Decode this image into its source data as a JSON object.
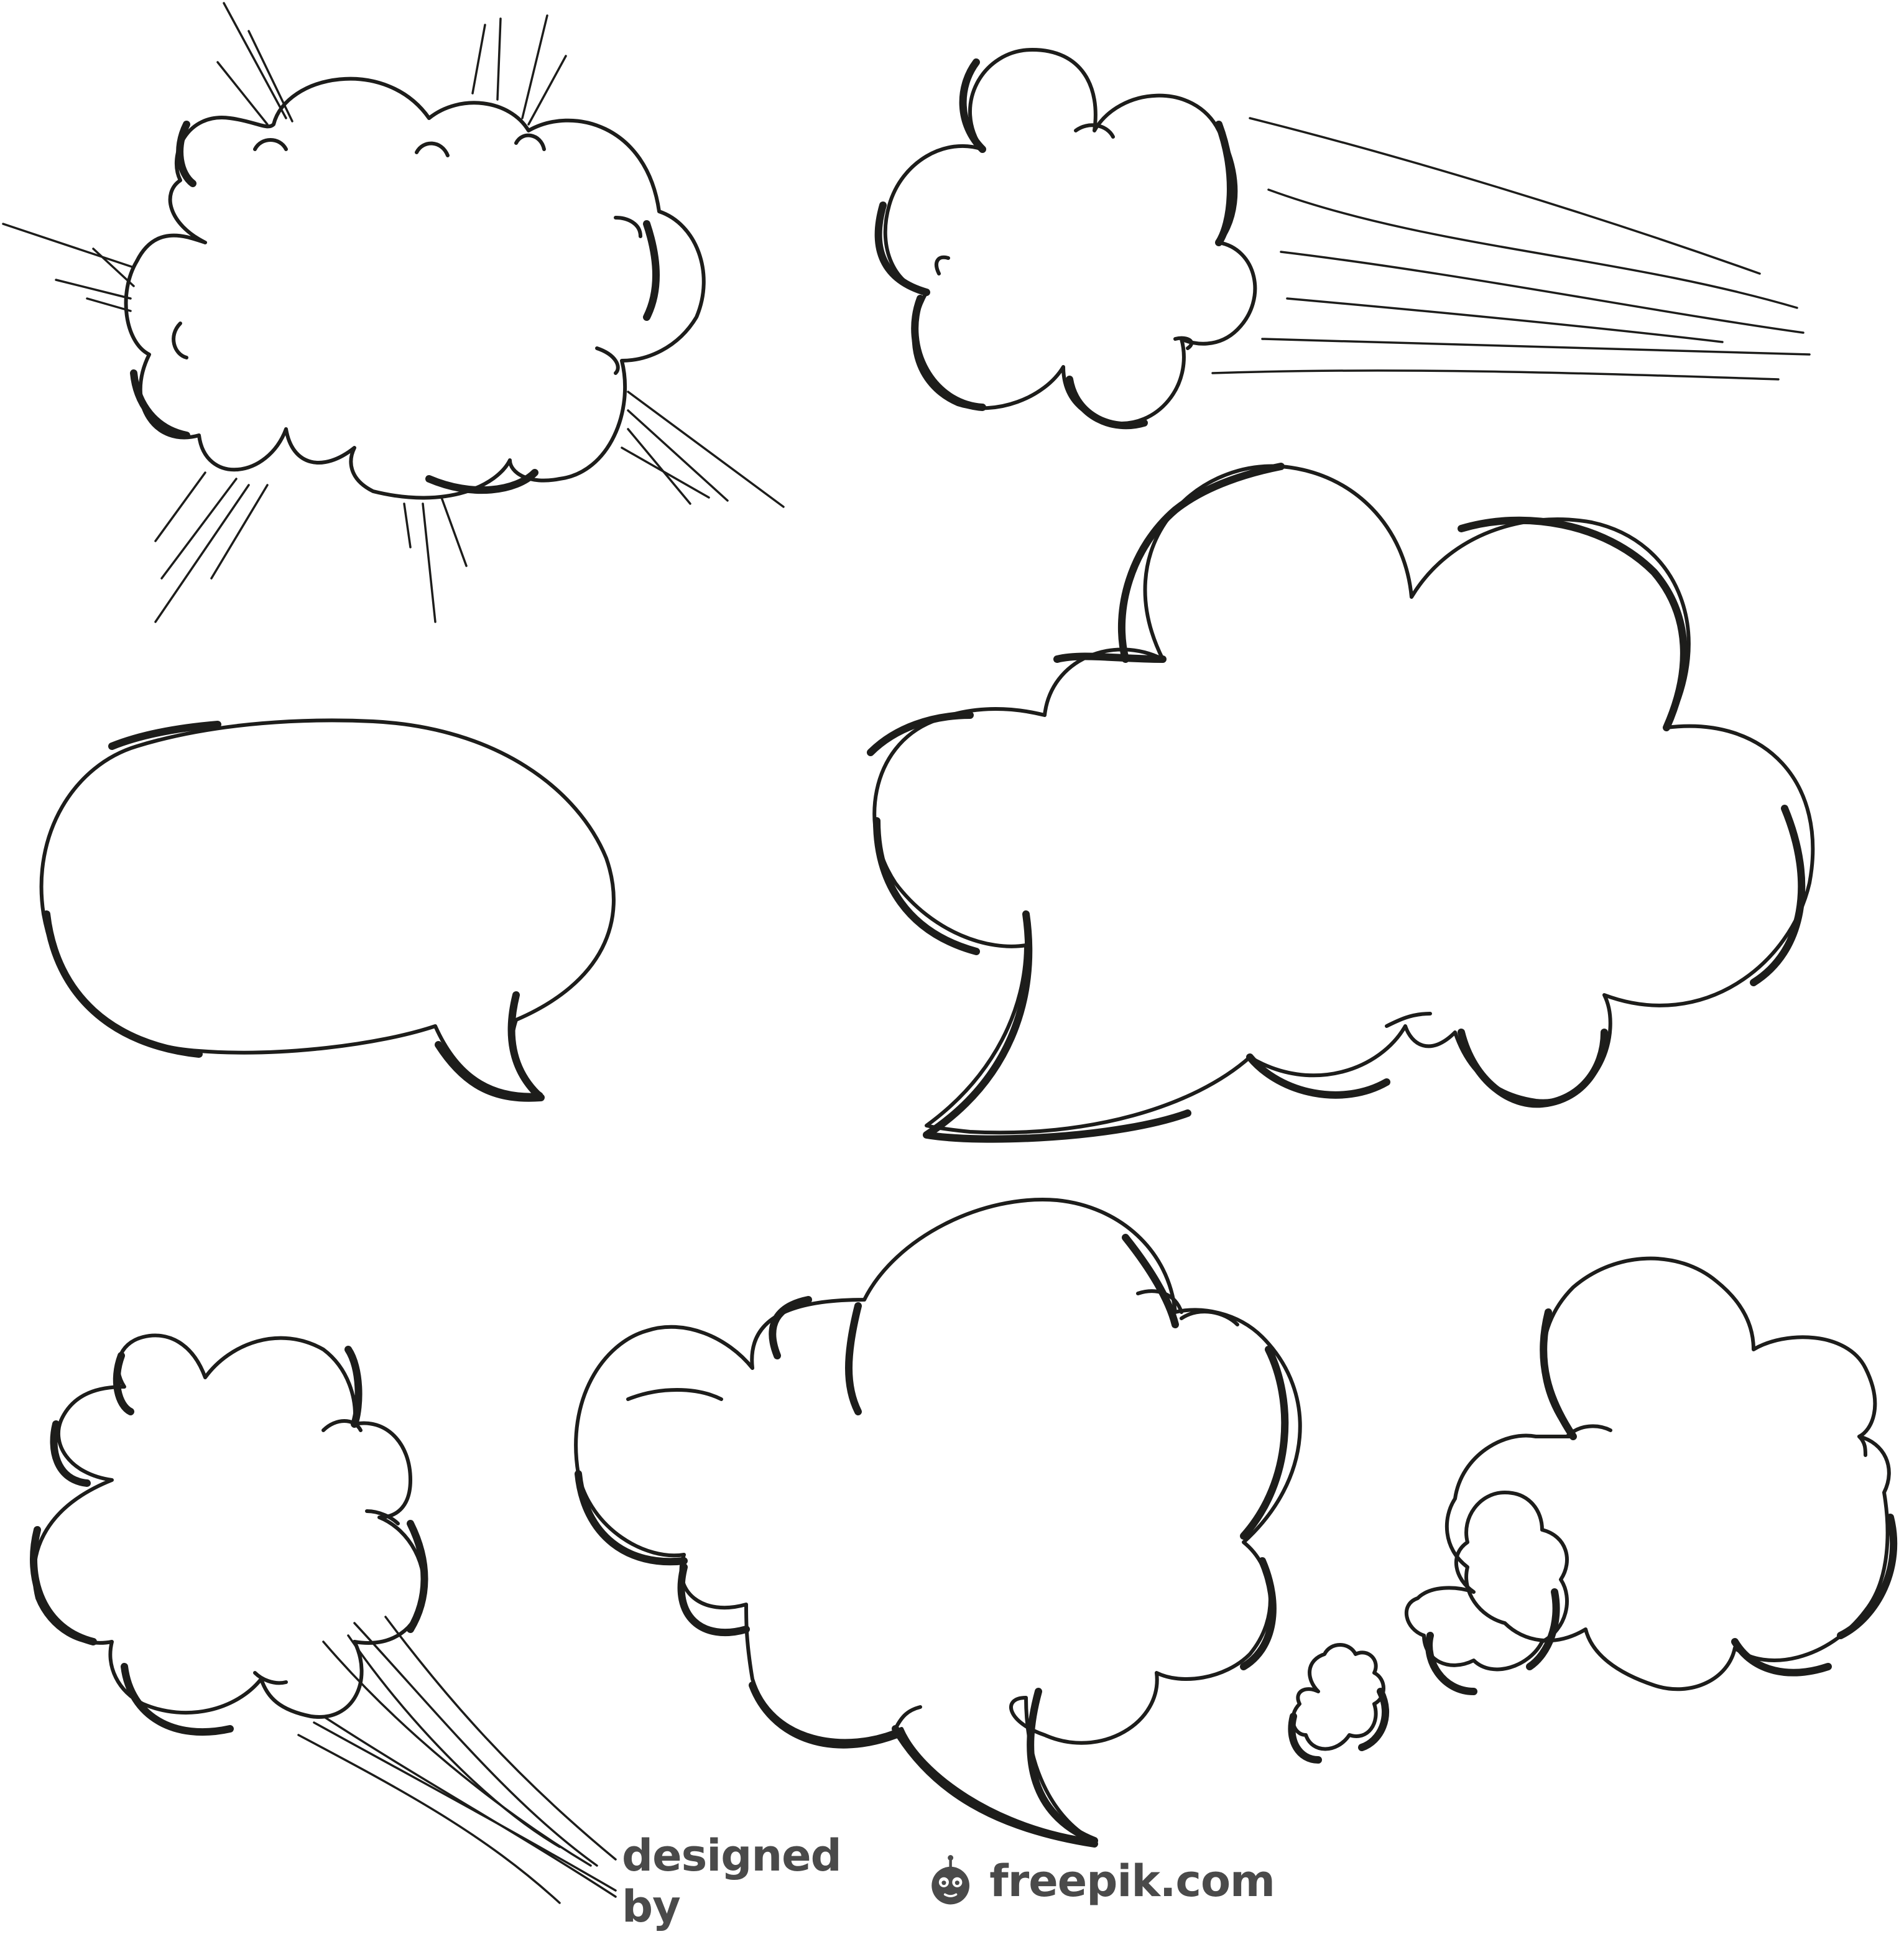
{
  "credit": {
    "prefix": "designed by",
    "brand": "freepik.com",
    "logo_icon": "freepik-logo-icon"
  },
  "colors": {
    "ink": "#1d1d1b",
    "credit_text": "#4a4a4a",
    "background": "#ffffff"
  },
  "illustrations": [
    {
      "name": "explosion-cloud-bubble"
    },
    {
      "name": "puff-cloud-with-speed-lines"
    },
    {
      "name": "oval-speech-bubble"
    },
    {
      "name": "large-cloud-speech-bubble"
    },
    {
      "name": "small-puff-cloud-with-trail"
    },
    {
      "name": "middle-cloud-speech-bubble"
    },
    {
      "name": "thought-bubble-chain"
    }
  ]
}
